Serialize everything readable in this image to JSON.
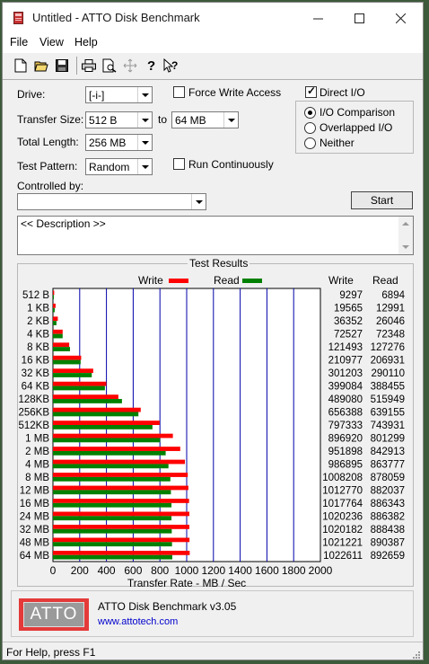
{
  "window": {
    "title": "Untitled - ATTO Disk Benchmark"
  },
  "menu": [
    "File",
    "View",
    "Help"
  ],
  "toolbar_icons": [
    "new-file-icon",
    "open-folder-icon",
    "save-icon",
    "print-icon",
    "print-preview-icon",
    "move-icon",
    "help-icon",
    "context-help-icon"
  ],
  "settings": {
    "drive_label": "Drive:",
    "drive_value": "[-i-]",
    "force_write_access_label": "Force Write Access",
    "force_write_access_checked": false,
    "direct_io_label": "Direct I/O",
    "direct_io_checked": true,
    "transfer_size_label": "Transfer Size:",
    "transfer_size_from": "512 B",
    "to_label": "to",
    "transfer_size_to": "64 MB",
    "total_length_label": "Total Length:",
    "total_length_value": "256 MB",
    "test_pattern_label": "Test Pattern:",
    "test_pattern_value": "Random",
    "run_continuously_label": "Run Continuously",
    "run_continuously_checked": false,
    "io_comparison_label": "I/O Comparison",
    "overlapped_io_label": "Overlapped I/O",
    "neither_label": "Neither",
    "selected_io_mode": "io_comparison",
    "controlled_by_label": "Controlled by:",
    "controlled_by_value": "",
    "start_label": "Start",
    "description_text": "<< Description >>"
  },
  "results_title": "Test Results",
  "chart_data": {
    "type": "bar",
    "orientation": "horizontal",
    "categories": [
      "512 B",
      "1 KB",
      "2 KB",
      "4 KB",
      "8 KB",
      "16 KB",
      "32 KB",
      "64 KB",
      "128KB",
      "256KB",
      "512KB",
      "1 MB",
      "2 MB",
      "4 MB",
      "8 MB",
      "12 MB",
      "16 MB",
      "24 MB",
      "32 MB",
      "48 MB",
      "64 MB"
    ],
    "series": [
      {
        "name": "Write",
        "color": "#ff0000",
        "values": [
          9297,
          19565,
          36352,
          72527,
          121493,
          210977,
          301203,
          399084,
          489080,
          656388,
          797333,
          896920,
          951898,
          986895,
          1008208,
          1012770,
          1017764,
          1020236,
          1020182,
          1021221,
          1022611
        ]
      },
      {
        "name": "Read",
        "color": "#008000",
        "values": [
          6894,
          12991,
          26046,
          72348,
          127276,
          206931,
          290110,
          388455,
          515949,
          639155,
          743931,
          801299,
          842913,
          863777,
          878059,
          882037,
          886343,
          886382,
          888438,
          890387,
          892659
        ]
      }
    ],
    "write_header": "Write",
    "read_header": "Read",
    "write_values_text": [
      "9297",
      "19565",
      "36352",
      "72527",
      "121493",
      "210977",
      "301203",
      "399084",
      "489080",
      "656388",
      "797333",
      "896920",
      "951898",
      "986895",
      "1008208",
      "1012770",
      "1017764",
      "1020236",
      "1020182",
      "1021221",
      "1022611"
    ],
    "read_values_text": [
      "6894",
      "12991",
      "26046",
      "72348",
      "127276",
      "206931",
      "290110",
      "388455",
      "515949",
      "639155",
      "743931",
      "801299",
      "842913",
      "863777",
      "878059",
      "882037",
      "886343",
      "886382",
      "888438",
      "890387",
      "892659"
    ],
    "x_ticks": [
      "0",
      "200",
      "400",
      "600",
      "800",
      "1000",
      "1200",
      "1400",
      "1600",
      "1800",
      "2000"
    ],
    "xlim": [
      0,
      2000
    ],
    "xlabel": "Transfer Rate - MB / Sec",
    "grid": true,
    "legend": "top"
  },
  "footer": {
    "logo_text": "ATTO",
    "product_name": "ATTO Disk Benchmark v3.05",
    "website": "www.attotech.com"
  },
  "status": {
    "text": "For Help, press F1"
  }
}
